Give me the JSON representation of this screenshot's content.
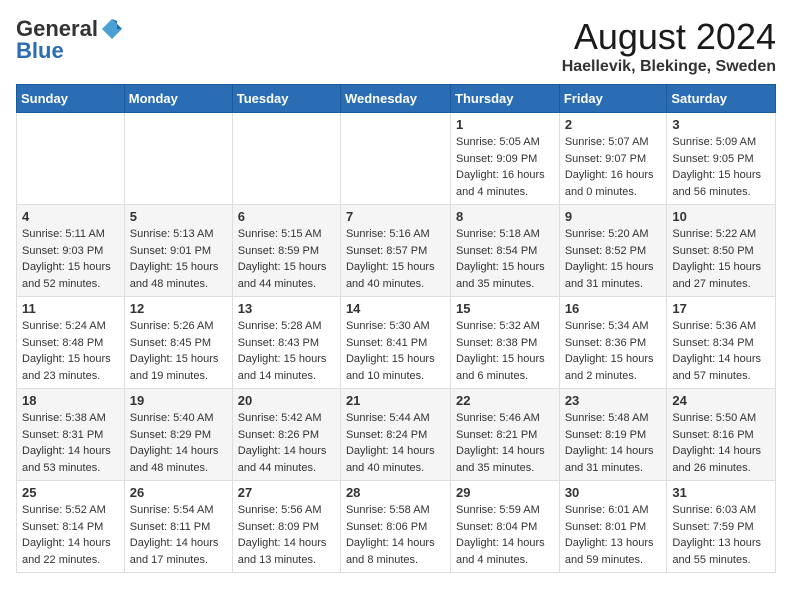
{
  "header": {
    "logo_general": "General",
    "logo_blue": "Blue",
    "month_year": "August 2024",
    "location": "Haellevik, Blekinge, Sweden"
  },
  "weekdays": [
    "Sunday",
    "Monday",
    "Tuesday",
    "Wednesday",
    "Thursday",
    "Friday",
    "Saturday"
  ],
  "weeks": [
    [
      {
        "day": "",
        "info": ""
      },
      {
        "day": "",
        "info": ""
      },
      {
        "day": "",
        "info": ""
      },
      {
        "day": "",
        "info": ""
      },
      {
        "day": "1",
        "info": "Sunrise: 5:05 AM\nSunset: 9:09 PM\nDaylight: 16 hours\nand 4 minutes."
      },
      {
        "day": "2",
        "info": "Sunrise: 5:07 AM\nSunset: 9:07 PM\nDaylight: 16 hours\nand 0 minutes."
      },
      {
        "day": "3",
        "info": "Sunrise: 5:09 AM\nSunset: 9:05 PM\nDaylight: 15 hours\nand 56 minutes."
      }
    ],
    [
      {
        "day": "4",
        "info": "Sunrise: 5:11 AM\nSunset: 9:03 PM\nDaylight: 15 hours\nand 52 minutes."
      },
      {
        "day": "5",
        "info": "Sunrise: 5:13 AM\nSunset: 9:01 PM\nDaylight: 15 hours\nand 48 minutes."
      },
      {
        "day": "6",
        "info": "Sunrise: 5:15 AM\nSunset: 8:59 PM\nDaylight: 15 hours\nand 44 minutes."
      },
      {
        "day": "7",
        "info": "Sunrise: 5:16 AM\nSunset: 8:57 PM\nDaylight: 15 hours\nand 40 minutes."
      },
      {
        "day": "8",
        "info": "Sunrise: 5:18 AM\nSunset: 8:54 PM\nDaylight: 15 hours\nand 35 minutes."
      },
      {
        "day": "9",
        "info": "Sunrise: 5:20 AM\nSunset: 8:52 PM\nDaylight: 15 hours\nand 31 minutes."
      },
      {
        "day": "10",
        "info": "Sunrise: 5:22 AM\nSunset: 8:50 PM\nDaylight: 15 hours\nand 27 minutes."
      }
    ],
    [
      {
        "day": "11",
        "info": "Sunrise: 5:24 AM\nSunset: 8:48 PM\nDaylight: 15 hours\nand 23 minutes."
      },
      {
        "day": "12",
        "info": "Sunrise: 5:26 AM\nSunset: 8:45 PM\nDaylight: 15 hours\nand 19 minutes."
      },
      {
        "day": "13",
        "info": "Sunrise: 5:28 AM\nSunset: 8:43 PM\nDaylight: 15 hours\nand 14 minutes."
      },
      {
        "day": "14",
        "info": "Sunrise: 5:30 AM\nSunset: 8:41 PM\nDaylight: 15 hours\nand 10 minutes."
      },
      {
        "day": "15",
        "info": "Sunrise: 5:32 AM\nSunset: 8:38 PM\nDaylight: 15 hours\nand 6 minutes."
      },
      {
        "day": "16",
        "info": "Sunrise: 5:34 AM\nSunset: 8:36 PM\nDaylight: 15 hours\nand 2 minutes."
      },
      {
        "day": "17",
        "info": "Sunrise: 5:36 AM\nSunset: 8:34 PM\nDaylight: 14 hours\nand 57 minutes."
      }
    ],
    [
      {
        "day": "18",
        "info": "Sunrise: 5:38 AM\nSunset: 8:31 PM\nDaylight: 14 hours\nand 53 minutes."
      },
      {
        "day": "19",
        "info": "Sunrise: 5:40 AM\nSunset: 8:29 PM\nDaylight: 14 hours\nand 48 minutes."
      },
      {
        "day": "20",
        "info": "Sunrise: 5:42 AM\nSunset: 8:26 PM\nDaylight: 14 hours\nand 44 minutes."
      },
      {
        "day": "21",
        "info": "Sunrise: 5:44 AM\nSunset: 8:24 PM\nDaylight: 14 hours\nand 40 minutes."
      },
      {
        "day": "22",
        "info": "Sunrise: 5:46 AM\nSunset: 8:21 PM\nDaylight: 14 hours\nand 35 minutes."
      },
      {
        "day": "23",
        "info": "Sunrise: 5:48 AM\nSunset: 8:19 PM\nDaylight: 14 hours\nand 31 minutes."
      },
      {
        "day": "24",
        "info": "Sunrise: 5:50 AM\nSunset: 8:16 PM\nDaylight: 14 hours\nand 26 minutes."
      }
    ],
    [
      {
        "day": "25",
        "info": "Sunrise: 5:52 AM\nSunset: 8:14 PM\nDaylight: 14 hours\nand 22 minutes."
      },
      {
        "day": "26",
        "info": "Sunrise: 5:54 AM\nSunset: 8:11 PM\nDaylight: 14 hours\nand 17 minutes."
      },
      {
        "day": "27",
        "info": "Sunrise: 5:56 AM\nSunset: 8:09 PM\nDaylight: 14 hours\nand 13 minutes."
      },
      {
        "day": "28",
        "info": "Sunrise: 5:58 AM\nSunset: 8:06 PM\nDaylight: 14 hours\nand 8 minutes."
      },
      {
        "day": "29",
        "info": "Sunrise: 5:59 AM\nSunset: 8:04 PM\nDaylight: 14 hours\nand 4 minutes."
      },
      {
        "day": "30",
        "info": "Sunrise: 6:01 AM\nSunset: 8:01 PM\nDaylight: 13 hours\nand 59 minutes."
      },
      {
        "day": "31",
        "info": "Sunrise: 6:03 AM\nSunset: 7:59 PM\nDaylight: 13 hours\nand 55 minutes."
      }
    ]
  ]
}
